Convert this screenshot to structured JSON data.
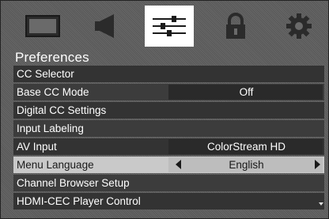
{
  "icons": [
    "picture-icon",
    "audio-icon",
    "preferences-icon",
    "lock-icon",
    "settings-icon"
  ],
  "active_icon": 2,
  "title": "Preferences",
  "rows": [
    {
      "label": "CC Selector",
      "value": ""
    },
    {
      "label": "Base CC Mode",
      "value": "Off"
    },
    {
      "label": "Digital CC Settings",
      "value": ""
    },
    {
      "label": "Input Labeling",
      "value": ""
    },
    {
      "label": "AV Input",
      "value": "ColorStream HD"
    },
    {
      "label": "Menu Language",
      "value": "English"
    },
    {
      "label": "Channel Browser Setup",
      "value": ""
    },
    {
      "label": "HDMI-CEC Player Control",
      "value": ""
    }
  ],
  "selected_row": 5
}
